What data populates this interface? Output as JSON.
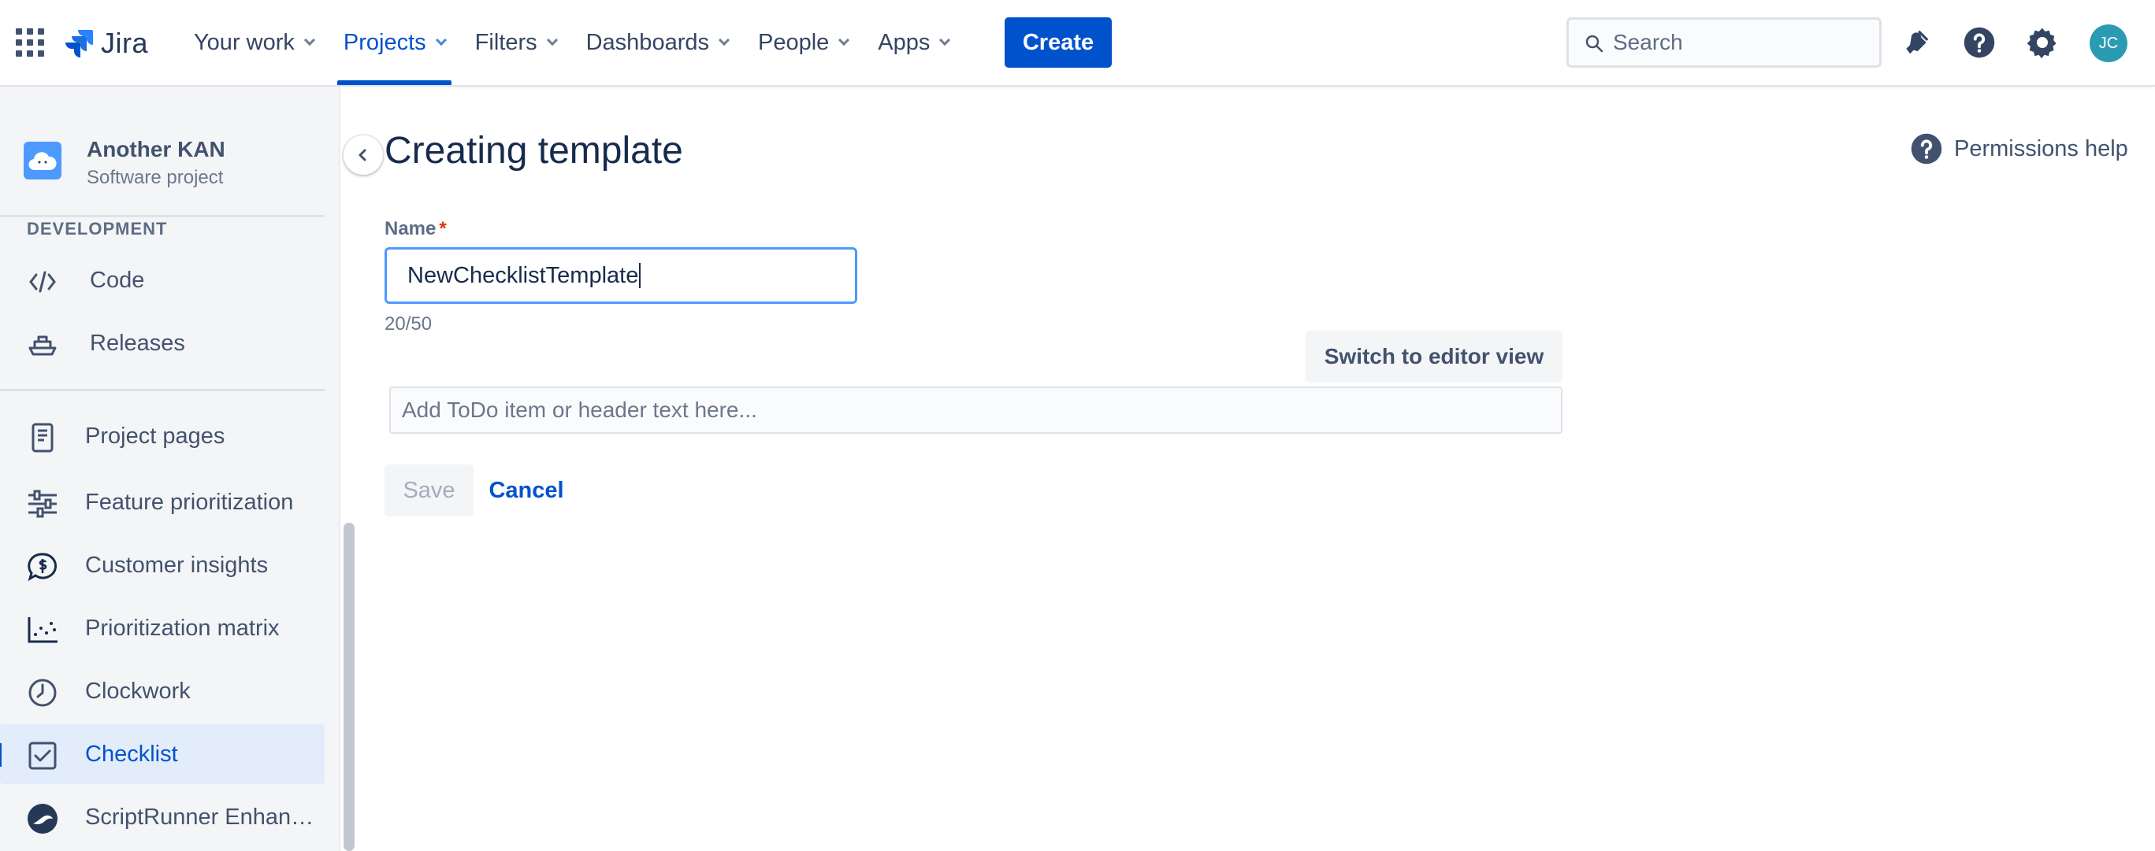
{
  "topnav": {
    "logo_text": "Jira",
    "items": [
      {
        "label": "Your work",
        "active": false
      },
      {
        "label": "Projects",
        "active": true
      },
      {
        "label": "Filters",
        "active": false
      },
      {
        "label": "Dashboards",
        "active": false
      },
      {
        "label": "People",
        "active": false
      },
      {
        "label": "Apps",
        "active": false
      }
    ],
    "create_label": "Create",
    "search_placeholder": "Search",
    "avatar_initials": "JC",
    "icons": [
      "app-switcher-icon",
      "notifications-icon",
      "help-icon",
      "settings-icon"
    ]
  },
  "sidebar": {
    "project_name": "Another KAN",
    "project_type": "Software project",
    "section_label": "DEVELOPMENT",
    "dev_items": [
      {
        "label": "Code",
        "icon": "code-icon"
      },
      {
        "label": "Releases",
        "icon": "ship-icon"
      }
    ],
    "items": [
      {
        "label": "Project pages",
        "icon": "page-icon"
      },
      {
        "label": "Feature prioritization",
        "icon": "sliders-icon"
      },
      {
        "label": "Customer insights",
        "icon": "dollar-chat-icon"
      },
      {
        "label": "Prioritization matrix",
        "icon": "scatter-icon"
      },
      {
        "label": "Clockwork",
        "icon": "clock-icon"
      },
      {
        "label": "Checklist",
        "icon": "checkbox-icon",
        "active": true
      },
      {
        "label": "ScriptRunner Enhan…",
        "icon": "scriptrunner-icon"
      }
    ]
  },
  "main": {
    "title": "Creating template",
    "permissions_help": "Permissions help",
    "name_label": "Name",
    "required_mark": "*",
    "name_value": "NewChecklistTemplate",
    "counter": "20/50",
    "switch_label": "Switch to editor view",
    "todo_placeholder": "Add ToDo item or header text here...",
    "save_label": "Save",
    "cancel_label": "Cancel"
  },
  "colors": {
    "brand": "#0052CC",
    "sidebar_bg": "#F4F5F7",
    "active_item_bg": "#E3ECFB",
    "required": "#DE350B",
    "focus_border": "#4C9AFF"
  }
}
